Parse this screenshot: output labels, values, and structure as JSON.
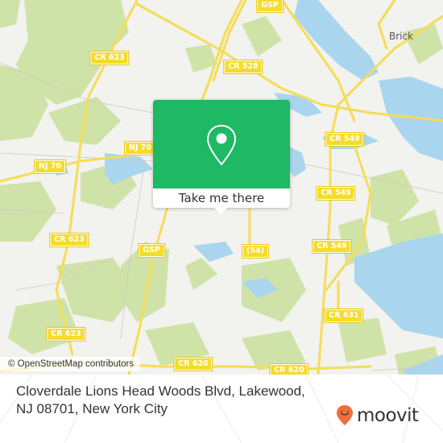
{
  "map": {
    "colors": {
      "background": "#f2f2ee",
      "forest": "#cfe3a8",
      "water": "#a9d6ee",
      "road": "#f5dd55",
      "brand": "#1fb865",
      "logo_orange": "#f26d3d"
    },
    "places": [
      {
        "name": "Brick"
      }
    ],
    "road_labels": [
      {
        "text": "GSP"
      },
      {
        "text": "CR 623"
      },
      {
        "text": "CR 528"
      },
      {
        "text": "NJ 70"
      },
      {
        "text": "NJ 70"
      },
      {
        "text": "CR 549"
      },
      {
        "text": "CR 549"
      },
      {
        "text": "CR 623"
      },
      {
        "text": "GSP"
      },
      {
        "text": "(54)"
      },
      {
        "text": "CR 549"
      },
      {
        "text": "CR 631"
      },
      {
        "text": "CR 623"
      },
      {
        "text": "CR 620"
      },
      {
        "text": "CR 620"
      }
    ],
    "attribution": "© OpenStreetMap contributors"
  },
  "popup": {
    "icon": "map-pin-icon",
    "button_label": "Take me there"
  },
  "footer": {
    "address": "Cloverdale Lions Head Woods Blvd, Lakewood, NJ 08701, New York City",
    "logo_text": "moovit"
  }
}
